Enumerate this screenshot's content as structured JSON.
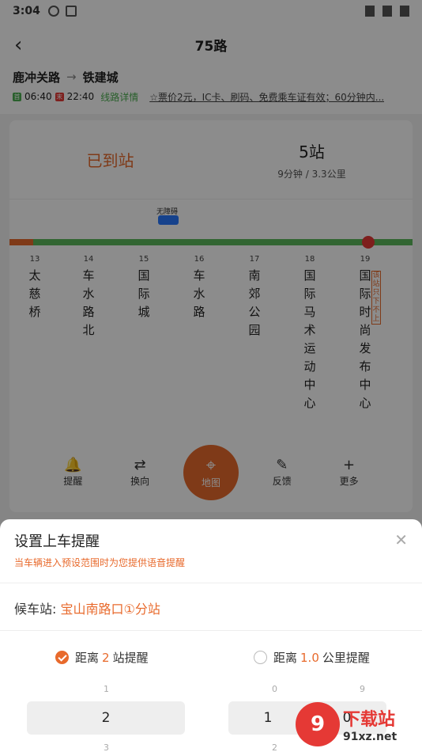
{
  "status": {
    "time": "3:04"
  },
  "nav": {
    "title": "75路"
  },
  "route": {
    "from": "鹿冲关路",
    "to": "铁建城",
    "first_tag": "首",
    "first_time": "06:40",
    "last_tag": "末",
    "last_time": "22:40",
    "detail": "线路详情",
    "notice": "☆票价2元，IC卡、刷码、免费乘车证有效；60分钟内..."
  },
  "card": {
    "arrived": "已到站",
    "stops": "5站",
    "sub": "9分钟 / 3.3公里",
    "bus_label": "无障碍",
    "side_tag": "该站只下不上"
  },
  "stations": [
    {
      "num": "13",
      "name": "太慈桥"
    },
    {
      "num": "14",
      "name": "车水路北"
    },
    {
      "num": "15",
      "name": "国际城"
    },
    {
      "num": "16",
      "name": "车水路"
    },
    {
      "num": "17",
      "name": "南郊公园"
    },
    {
      "num": "18",
      "name": "国际马术运动中心"
    },
    {
      "num": "19",
      "name": "国际时尚发布中心"
    }
  ],
  "toolbar": {
    "remind": "提醒",
    "reverse": "换向",
    "map": "地图",
    "feedback": "反馈",
    "more": "更多"
  },
  "sheet": {
    "title": "设置上车提醒",
    "subtitle": "当车辆进入预设范围时为您提供语音提醒",
    "station_label": "候车站:",
    "station_value": "宝山南路口①分站",
    "opt1_pre": "距离",
    "opt1_val": "2",
    "opt1_post": "站提醒",
    "opt2_pre": "距离",
    "opt2_val": "1.0",
    "opt2_post": "公里提醒",
    "picker1": {
      "above": "1",
      "value": "2",
      "below": "3"
    },
    "picker2": {
      "above_a": "0",
      "above_b": "9",
      "value_a": "1",
      "value_b": "0",
      "below": "2"
    }
  },
  "watermark": {
    "logo": "9",
    "a": "下载站",
    "b": "91xz.net"
  },
  "colors": {
    "accent": "#e86a2c",
    "green": "#5cb85c",
    "bus": "#2979ff"
  }
}
